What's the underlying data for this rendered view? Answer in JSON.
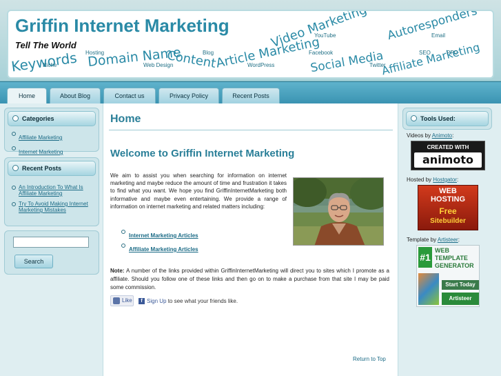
{
  "header": {
    "title": "Griffin Internet Marketing",
    "slogan": "Tell The World",
    "big_words": {
      "keywords": "Keywords",
      "domain_name": "Domain Name",
      "content": "Content",
      "article_marketing": "Article Marketing",
      "video_marketing": "Video Marketing",
      "social_media": "Social Media",
      "autoresponders": "Autoresponders",
      "affiliate_marketing": "Affiliate Marketing"
    },
    "small_words": {
      "hosting": "Hosting",
      "niche": "Niche",
      "web_design": "Web Design",
      "blog": "Blog",
      "youtube": "YouTube",
      "facebook": "Facebook",
      "wordpress": "WordPress",
      "twitter": "Twitter",
      "email": "Email",
      "seo": "SEO",
      "ppc": "PPC"
    }
  },
  "nav": {
    "tabs": [
      {
        "label": "Home",
        "active": true
      },
      {
        "label": "About Blog",
        "active": false
      },
      {
        "label": "Contact us",
        "active": false
      },
      {
        "label": "Privacy Policy",
        "active": false
      },
      {
        "label": "Recent Posts",
        "active": false
      }
    ]
  },
  "sidebar_left": {
    "categories": {
      "title": "Categories",
      "items": [
        "Affiliate Marketing",
        "Internet Marketing"
      ]
    },
    "recent_posts": {
      "title": "Recent Posts",
      "items": [
        "An Introduction To What Is Affiliate Marketing",
        "Try To Avoid Making Internet Marketing Mistakes"
      ]
    },
    "search": {
      "placeholder": "",
      "button_label": "Search"
    }
  },
  "main": {
    "page_title": "Home",
    "welcome": "Welcome to Griffin Internet Marketing",
    "intro": "We aim to assist you when searching for information on internet marketing and maybe reduce the amount of time and frustration it takes to find what you want. We hope you find GriffinInternetMarketing both informative and maybe even entertaining. We provide a range of information on internet marketing and related matters including:",
    "article_links": [
      "Internet Marketing Articles",
      "Affiliate Marketing Articles"
    ],
    "note_label": "Note:",
    "note_text": "A number of the links provided within GriffinInternetMarketing will direct you to sites which I promote as a affiliate. Should you follow one of these links and then go on to make a purchase from that site I may be paid some commission.",
    "facebook": {
      "like_label": "Like",
      "f_glyph": "f",
      "signup_label": "Sign Up",
      "signup_text": "to see what your friends like."
    },
    "return_to_top": "Return to Top"
  },
  "sidebar_right": {
    "title": "Tools Used:",
    "tools": [
      {
        "prefix": "Videos by",
        "link": "Animoto",
        "suffix": ":",
        "banner": [
          "CREATED WITH",
          "animoto"
        ]
      },
      {
        "prefix": "Hosted by",
        "link": "Hostgator",
        "suffix": ":",
        "banner": [
          "WEB",
          "HOSTING",
          "Free",
          "Sitebuilder"
        ]
      },
      {
        "prefix": "Template by",
        "link": "Artisteer",
        "suffix": ":",
        "banner": [
          "#1",
          "WEB",
          "TEMPLATE",
          "GENERATOR",
          "Start Today",
          "Artisteer"
        ]
      }
    ]
  },
  "colors": {
    "accent": "#2a8aa6",
    "link": "#1b6b86",
    "nav_bg": "#3a93b2",
    "sidebar_bg": "#dfeef1"
  }
}
